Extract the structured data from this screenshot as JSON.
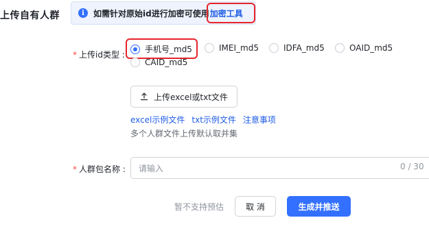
{
  "section": {
    "title": "上传自有人群"
  },
  "info": {
    "text": "如需针对原始id进行加密可使用",
    "link": "加密工具"
  },
  "id_type": {
    "label": "上传id类型 :",
    "required_mark": "*",
    "options": [
      "手机号_md5",
      "IMEI_md5",
      "IDFA_md5",
      "OAID_md5",
      "CAID_md5"
    ],
    "selected": "手机号_md5"
  },
  "upload": {
    "button_label": "上传excel或txt文件",
    "links": [
      "excel示例文件",
      "txt示例文件",
      "注意事项"
    ],
    "hint": "多个人群文件上传默认取并集"
  },
  "crowd_name": {
    "label": "人群包名称 :",
    "required_mark": "*",
    "placeholder": "请输入",
    "counter": "0 / 30"
  },
  "footer": {
    "note": "暂不支持预估",
    "cancel_label": "取 消",
    "submit_label": "生成并推送"
  },
  "colors": {
    "primary": "#3370ff",
    "link": "#1f5ce6",
    "highlight": "#e5242b",
    "required": "#f54a45"
  }
}
